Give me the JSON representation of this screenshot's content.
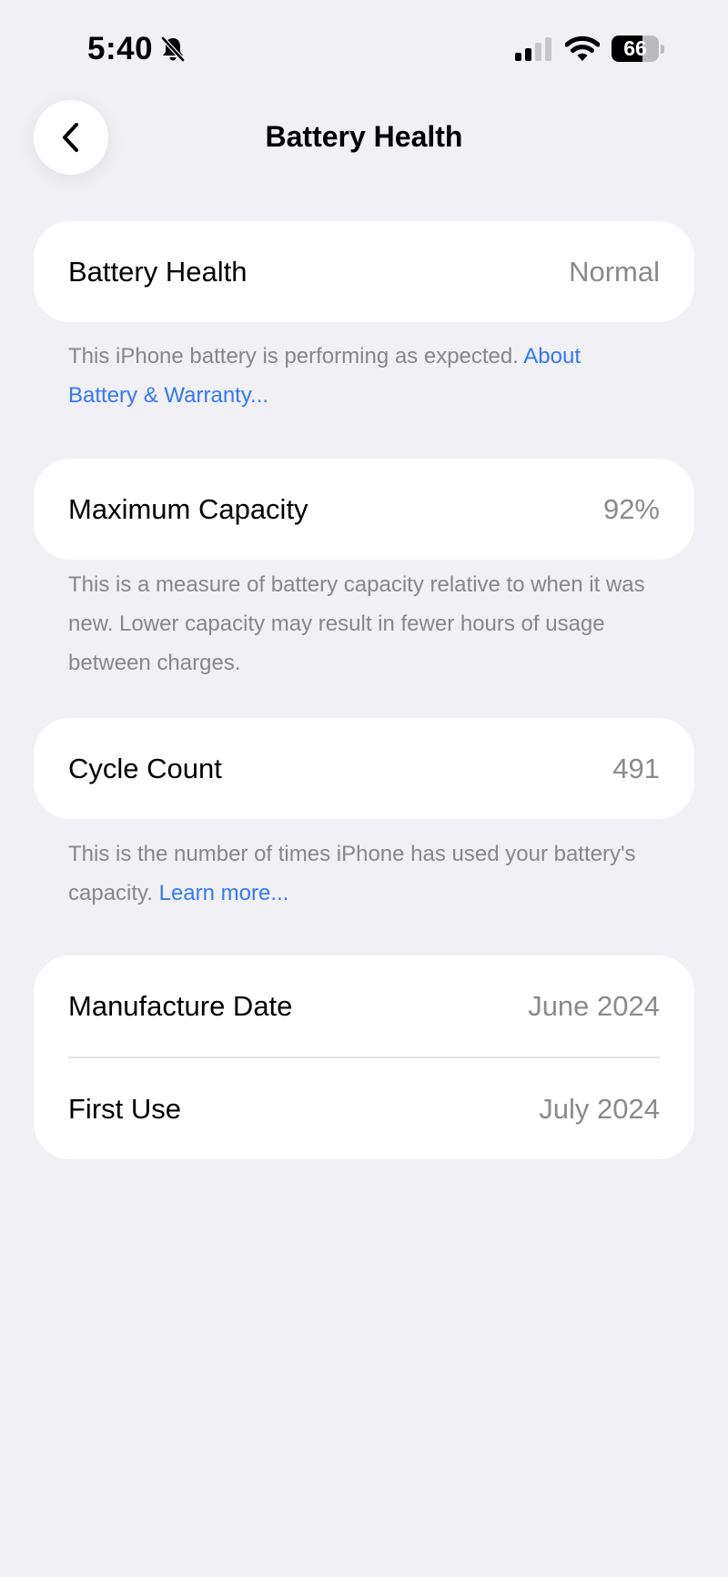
{
  "status_bar": {
    "time": "5:40",
    "battery_level": 66,
    "battery_text": "66"
  },
  "nav": {
    "title": "Battery Health"
  },
  "sections": {
    "health": {
      "label": "Battery Health",
      "value": "Normal",
      "footnote": "This iPhone battery is performing as expected. ",
      "link": "About Battery & Warranty..."
    },
    "capacity": {
      "label": "Maximum Capacity",
      "value": "92%",
      "footnote": "This is a measure of battery capacity relative to when it was new. Lower capacity may result in fewer hours of usage between charges."
    },
    "cycles": {
      "label": "Cycle Count",
      "value": "491",
      "footnote": "This is the number of times iPhone has used your battery's capacity. ",
      "link": "Learn more..."
    },
    "dates": {
      "manufacture_label": "Manufacture Date",
      "manufacture_value": "June 2024",
      "first_use_label": "First Use",
      "first_use_value": "July 2024"
    }
  },
  "colors": {
    "background": "#f0f0f5",
    "link": "#3478f6",
    "secondary_text": "#8a8a8e"
  }
}
